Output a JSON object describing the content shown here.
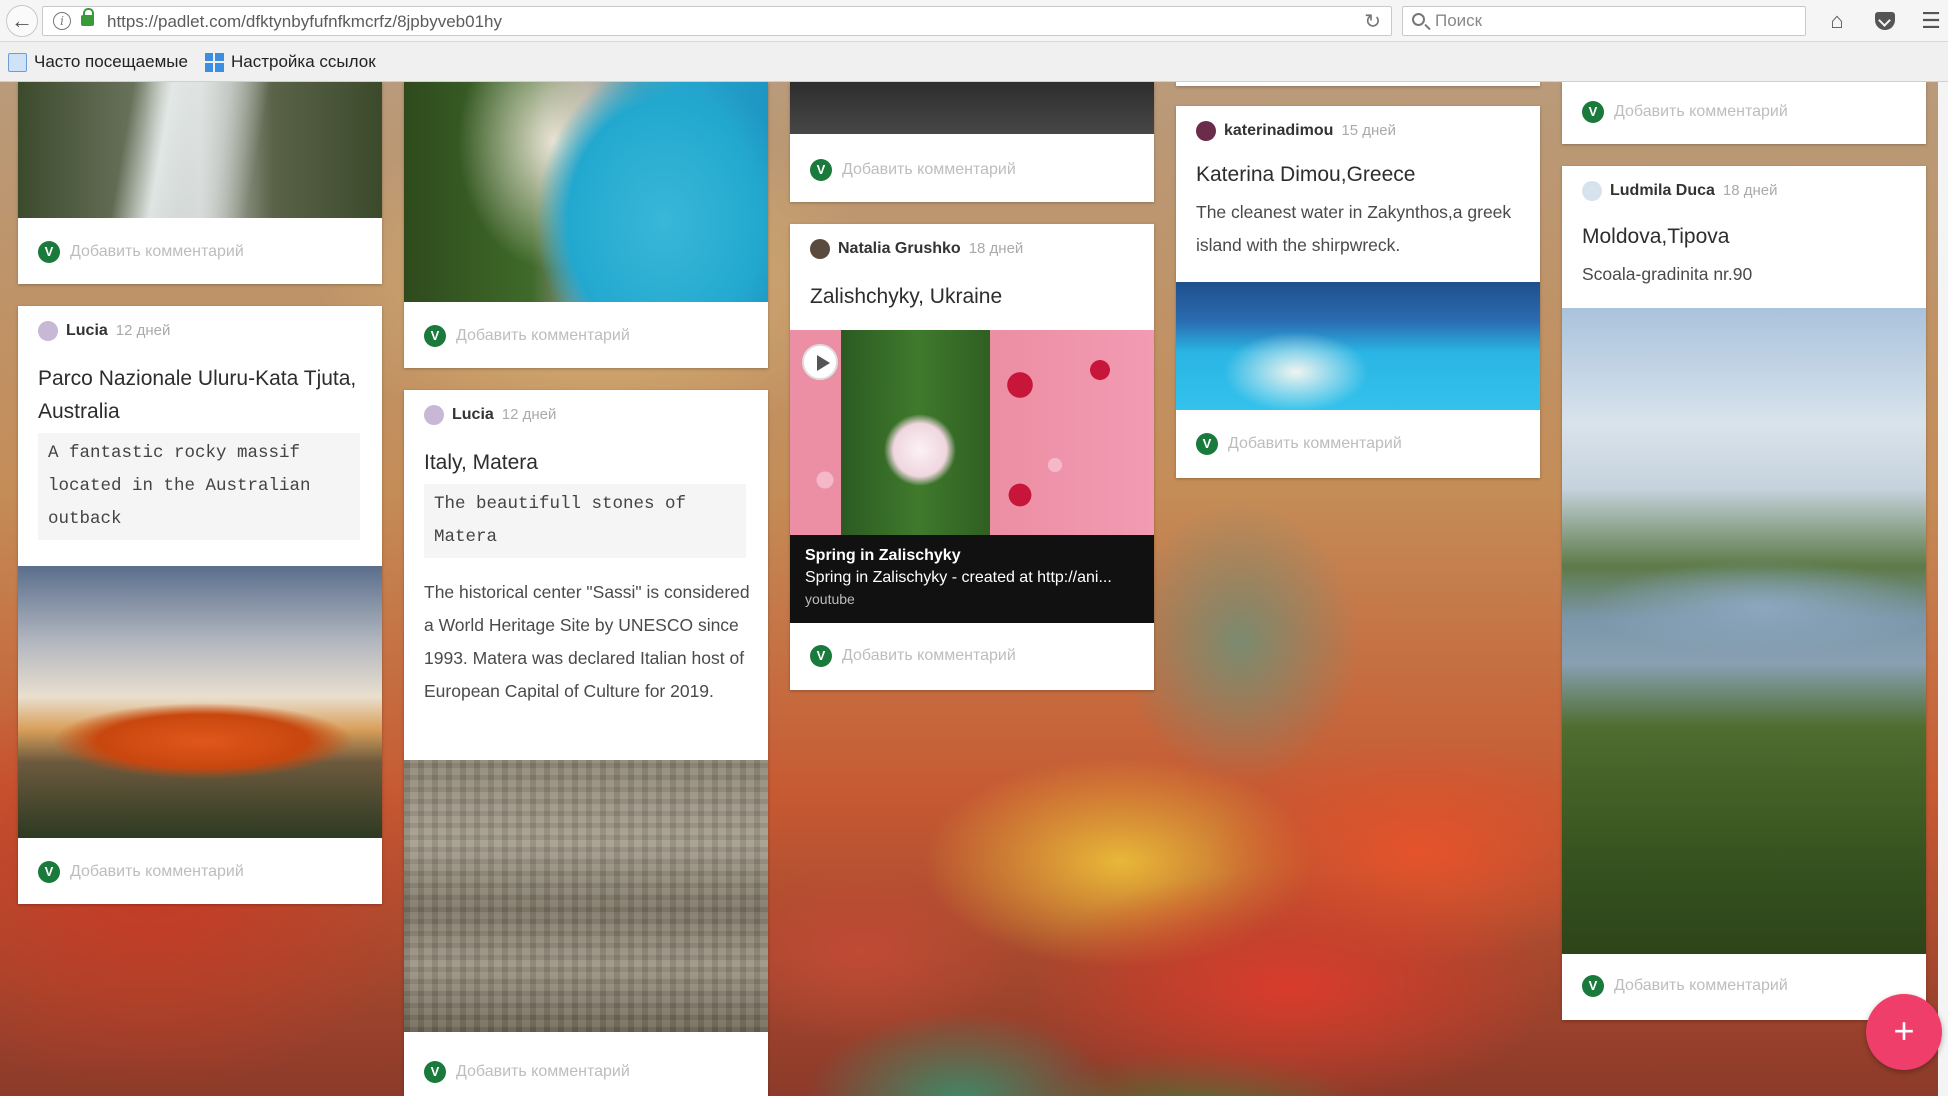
{
  "browser": {
    "url": "https://padlet.com/dfktynbyfufnfkmcrfz/8jpbyveb01hy",
    "search_placeholder": "Поиск",
    "bookmarks": [
      "Часто посещаемые",
      "Настройка ссылок"
    ]
  },
  "comment_placeholder": "Добавить комментарий",
  "comment_avatar_letter": "V",
  "cards": {
    "lucia_uluru": {
      "author": "Lucia",
      "age": "12 дней",
      "title": "Parco Nazionale Uluru-Kata Tjuta, Australia",
      "code": "A fantastic rocky massif located in the Australian outback"
    },
    "lucia_matera": {
      "author": "Lucia",
      "age": "12 дней",
      "title": "Italy, Matera",
      "code": "The beautifull stones of Matera",
      "body": "The historical center \"Sassi\" is considered a World Heritage Site by UNESCO since 1993. Matera was declared Italian host of European Capital of Culture for 2019."
    },
    "natalia": {
      "author": "Natalia Grushko",
      "age": "18 дней",
      "title": "Zalishchyky, Ukraine",
      "video_title": "Spring in Zalischyky",
      "video_desc": "Spring in Zalischyky - created at http://ani...",
      "video_source": "youtube"
    },
    "katerina": {
      "author": "katerinadimou",
      "age": "15 дней",
      "title": "Katerina Dimou,Greece",
      "body": "The cleanest water in Zakynthos,a greek island with the shirpwreck."
    },
    "ludmila": {
      "author": "Ludmila Duca",
      "age": "18 дней",
      "title": "Moldova,Tipova",
      "body": "Scoala-gradinita nr.90"
    }
  },
  "fab_label": "+",
  "colors": {
    "fab": "#f03e6a",
    "comment_avatar": "#1a7a3c"
  }
}
